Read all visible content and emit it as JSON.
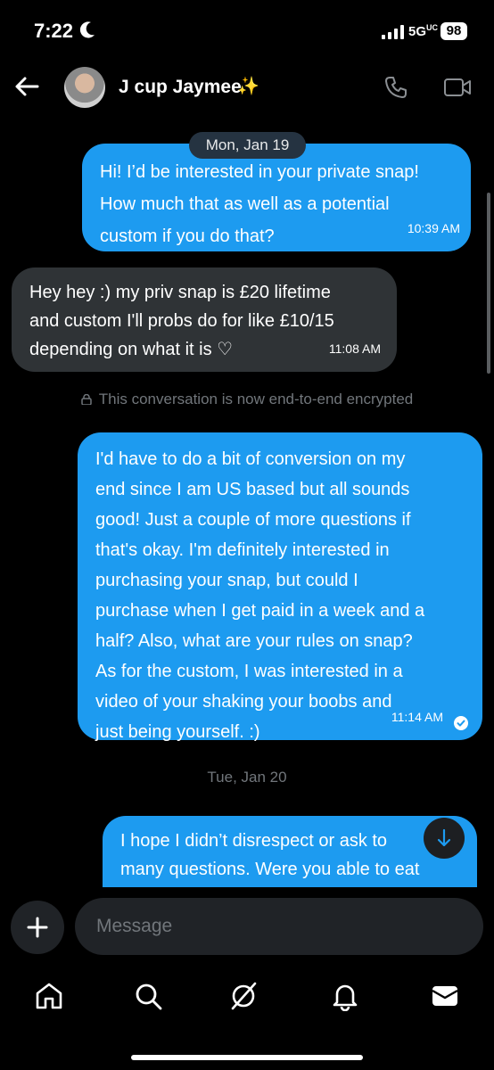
{
  "status_bar": {
    "time": "7:22",
    "network": "5G",
    "network_sup": "UC",
    "battery": "98"
  },
  "header": {
    "contact_name": "J cup Jaymee",
    "sparkle": "✨"
  },
  "messages": [
    {
      "type": "date",
      "text": "Mon, Jan 19"
    },
    {
      "type": "sent",
      "lines": [
        "Hi! I’d be interested in your private snap!",
        "How much that as well as a potential",
        "custom if you do that?"
      ],
      "time": "10:39 AM"
    },
    {
      "type": "received",
      "lines": [
        "Hey hey :) my priv snap is £20 lifetime",
        "and custom I'll probs do for like £10/15",
        "depending on what it is ♡"
      ],
      "time": "11:08 AM"
    },
    {
      "type": "notice",
      "text": "This conversation is now end-to-end encrypted"
    },
    {
      "type": "sent",
      "lines": [
        "I'd have to do a bit of conversion on my",
        "end since I am US based but all sounds",
        "good! Just a couple of more questions if",
        "that's okay. I'm definitely interested in",
        "purchasing your snap, but could I",
        "purchase when I get paid in a week and a",
        "half? Also, what are your rules on snap?",
        "As for the custom, I was interested in a",
        "video of your shaking your boobs and",
        "just being yourself. :)"
      ],
      "time": "11:14 AM"
    },
    {
      "type": "date",
      "text": "Tue, Jan 20"
    },
    {
      "type": "sent",
      "lines": [
        "I hope I didn’t disrespect or ask to",
        "many questions. Were you able to eat"
      ]
    }
  ],
  "composer": {
    "placeholder": "Message"
  },
  "nav": [
    "home-icon",
    "search-icon",
    "grok-icon",
    "notifications-icon",
    "messages-icon"
  ],
  "colors": {
    "sent_bubble": "#1d9bf0",
    "received_bubble": "#2f3336",
    "muted_text": "#71767b"
  }
}
